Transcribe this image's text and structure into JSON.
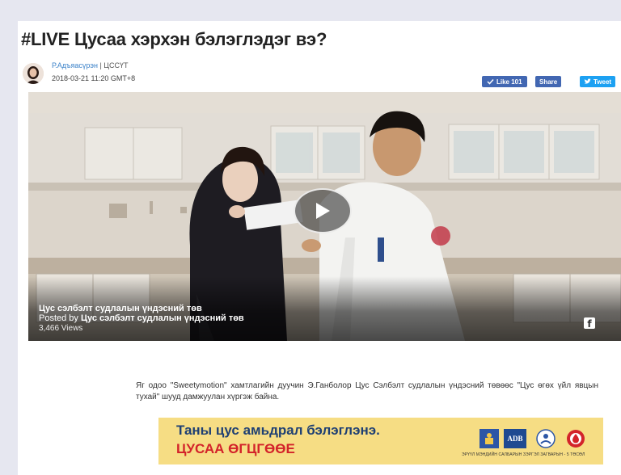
{
  "article": {
    "title": "#LIVE Цусаа хэрхэн бэлэглэдэг вэ?",
    "author": "Р.Адъяасүрэн",
    "separator": " | ",
    "outlet": "ЦССҮТ",
    "date": "2018-03-21 11:20 GMT+8"
  },
  "social": {
    "like_label": "Like 101",
    "share_label": "Share",
    "tweet_label": "Tweet"
  },
  "video": {
    "title": "Цус сэлбэлт судлалын үндэсний төв",
    "posted_prefix": "Posted by ",
    "posted_by": "Цус сэлбэлт судлалын үндэсний төв",
    "views": "3,466 Views"
  },
  "body": {
    "paragraph": "Яг одоо \"Sweetymotion\" хамтлагийн дуучин Э.Ганболор Цус Сэлбэлт судлалын үндэсний төвөөс \"Цус өгөх үйл явцын тухай\" шууд дамжуулан хүргэж байна."
  },
  "banner": {
    "line1": "Таны цус амьдрал бэлэглэнэ.",
    "line2": "ЦУСАА ӨГЦГӨӨЕ",
    "adb_label": "ADB",
    "small_text": "ЭРҮҮЛ МЭНДИЙН САЛБАРЫН ЗЭРГЭЛ ЗАГВАРЫН - 5 ТӨСӨЛ"
  },
  "colors": {
    "facebook": "#4267b2",
    "twitter": "#1da1f2",
    "banner_bg": "#f6dd84",
    "banner_red": "#d3232a",
    "banner_navy": "#1e3f73",
    "link": "#3b82c9"
  },
  "icons": {
    "like": "thumbs-up-check-icon",
    "tweet": "twitter-bird-icon",
    "play": "play-icon",
    "facebook": "facebook-icon"
  }
}
